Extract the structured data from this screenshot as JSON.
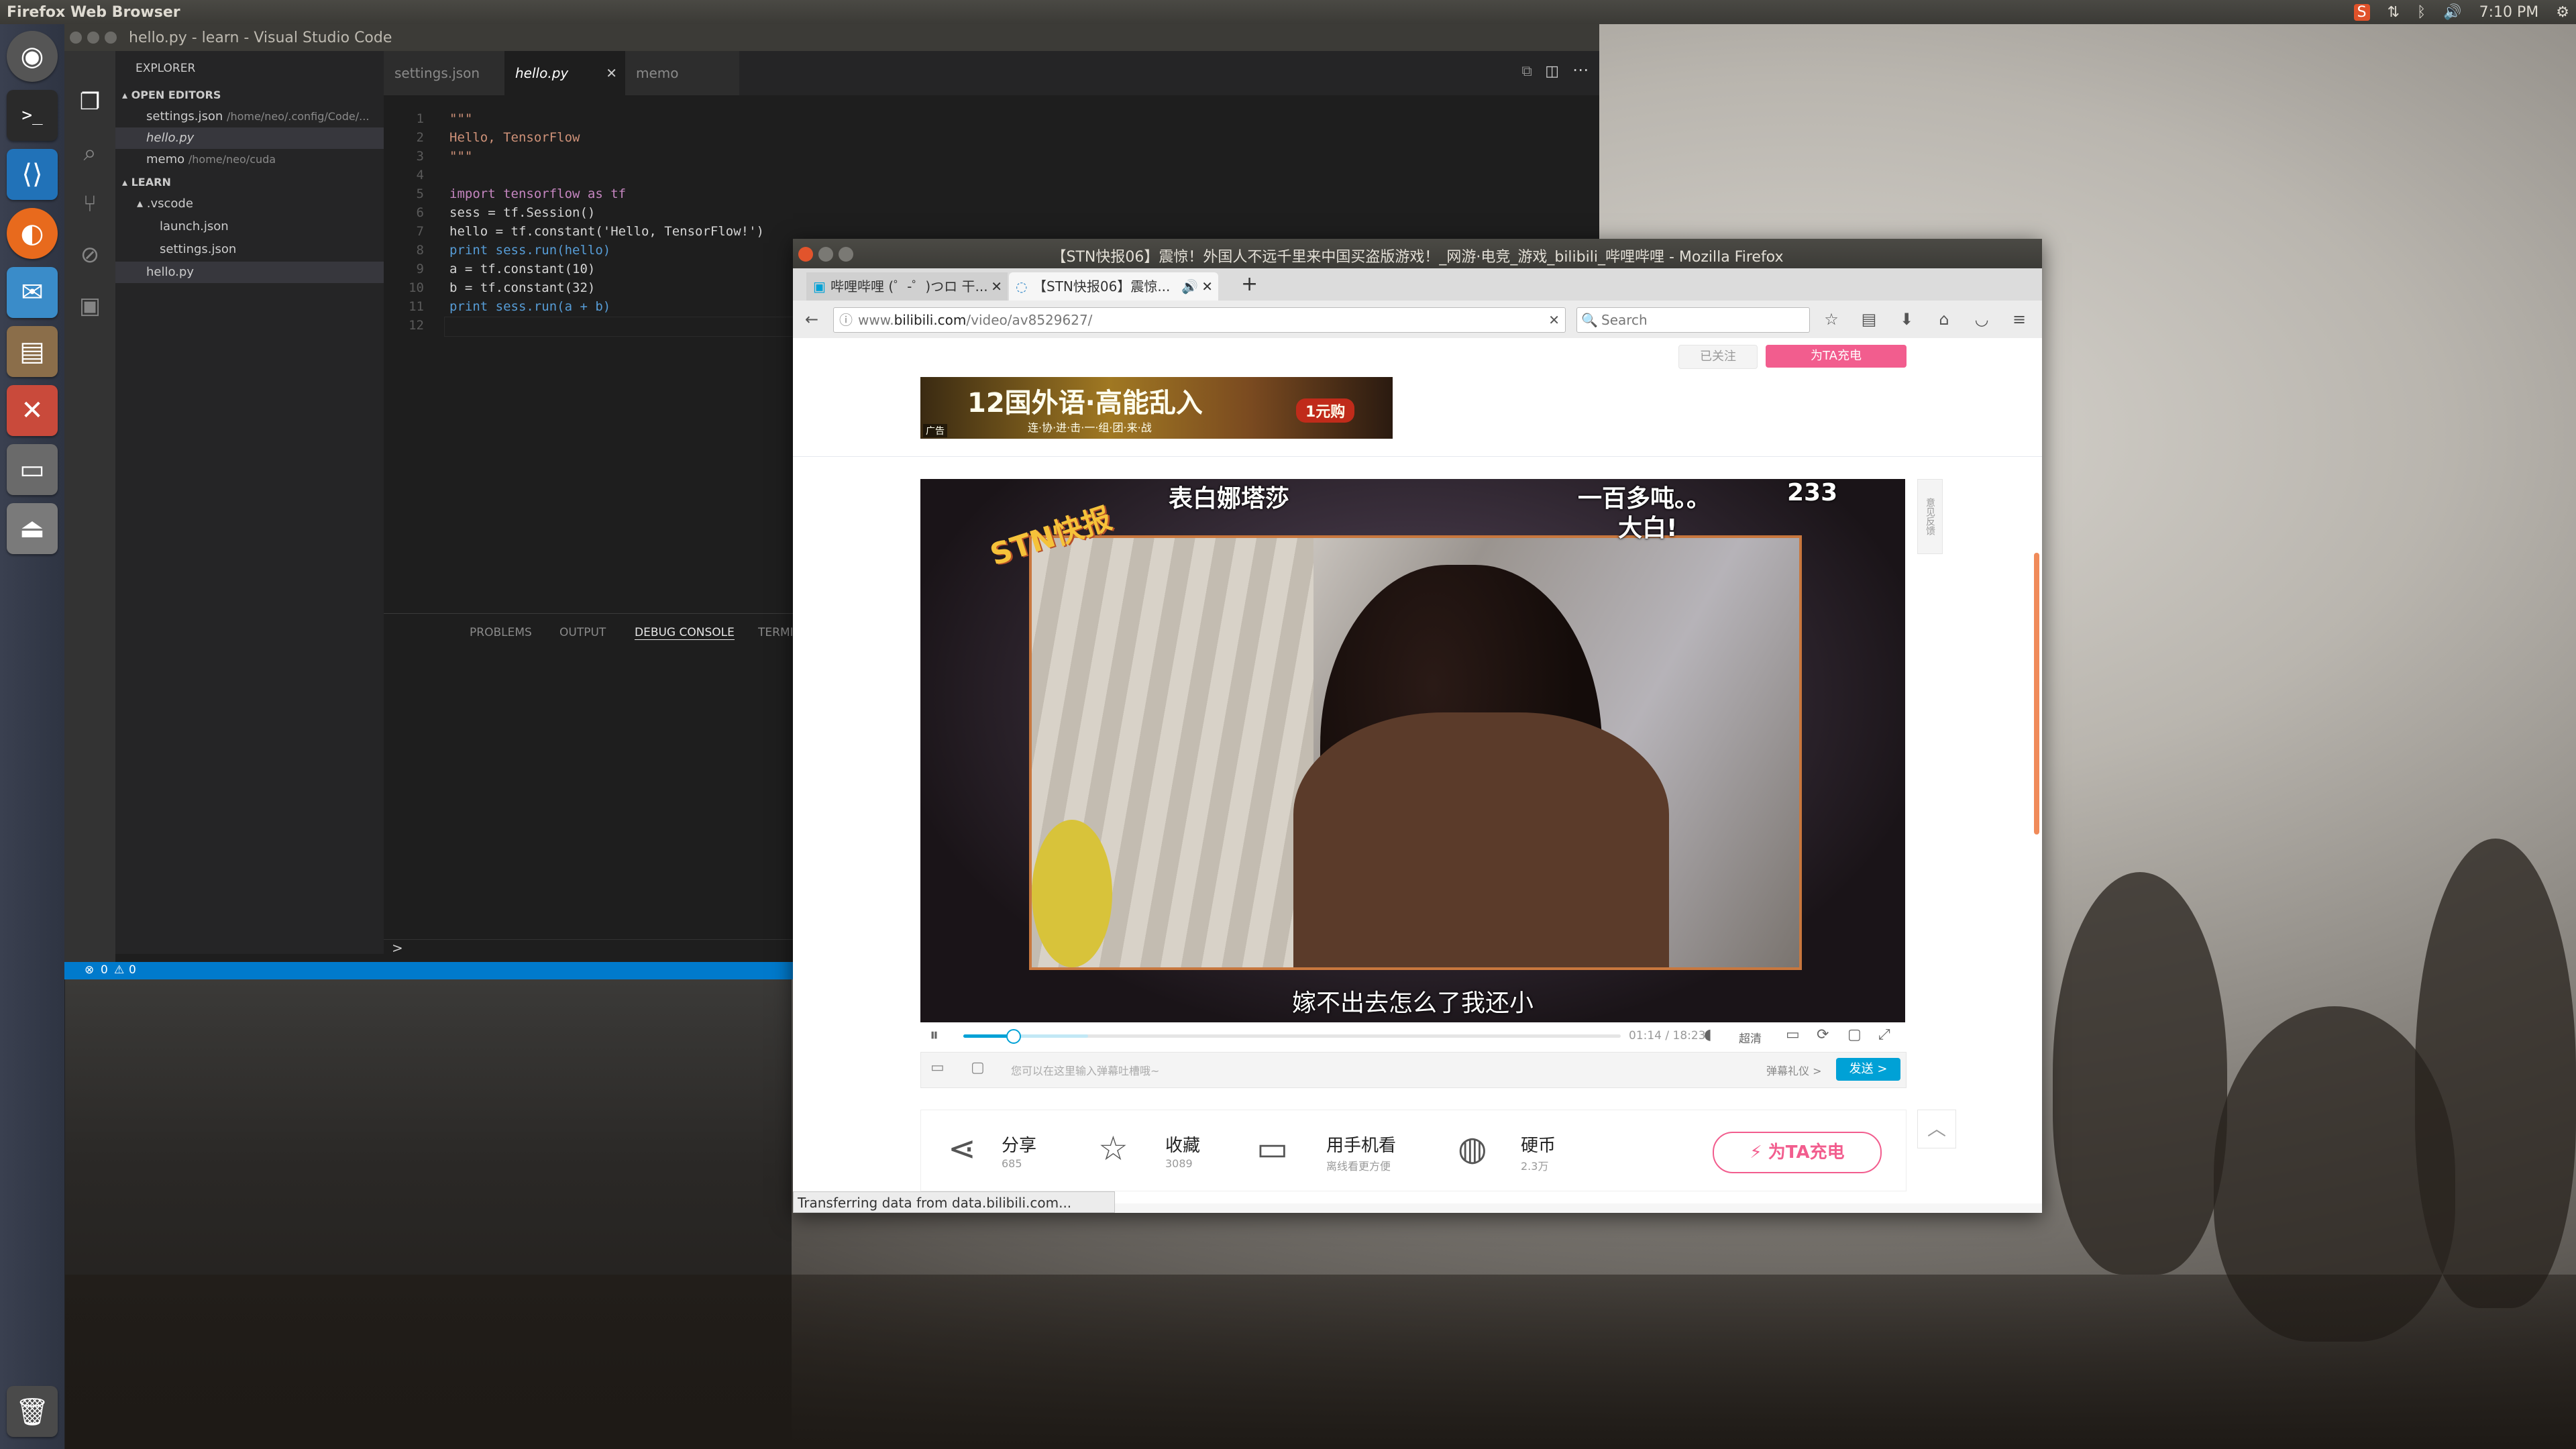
{
  "top_panel": {
    "title": "Firefox Web Browser",
    "time": "7:10 PM"
  },
  "vscode": {
    "window_title": "hello.py - learn - Visual Studio Code",
    "explorer_title": "EXPLORER",
    "open_editors_header": "OPEN EDITORS",
    "open_editors": [
      {
        "name": "settings.json",
        "path": "/home/neo/.config/Code/..."
      },
      {
        "name": "hello.py",
        "path": ""
      },
      {
        "name": "memo",
        "path": "/home/neo/cuda"
      }
    ],
    "learn_header": "LEARN",
    "tree": [
      {
        "name": ".vscode"
      },
      {
        "name": "launch.json"
      },
      {
        "name": "settings.json"
      },
      {
        "name": "hello.py"
      }
    ],
    "tabs": [
      {
        "label": "settings.json"
      },
      {
        "label": "hello.py"
      },
      {
        "label": "memo"
      }
    ],
    "code_lines": [
      "\"\"\"",
      "Hello, TensorFlow",
      "\"\"\"",
      "",
      "import tensorflow as tf",
      "sess = tf.Session()",
      "hello = tf.constant('Hello, TensorFlow!')",
      "print sess.run(hello)",
      "a = tf.constant(10)",
      "b = tf.constant(32)",
      "print sess.run(a + b)",
      ""
    ],
    "line_numbers": [
      "1",
      "2",
      "3",
      "4",
      "5",
      "6",
      "7",
      "8",
      "9",
      "10",
      "11",
      "12"
    ],
    "panel_tabs": [
      "PROBLEMS",
      "OUTPUT",
      "DEBUG CONSOLE",
      "TERMINAL"
    ],
    "prompt": ">",
    "status_errors": "0",
    "status_warnings": "0"
  },
  "firefox": {
    "window_title": "【STN快报06】震惊！外国人不远千里来中国买盗版游戏！_网游·电竞_游戏_bilibili_哔哩哔哩 - Mozilla Firefox",
    "tabs": [
      {
        "label": "哔哩哔哩 (゜-゜)つロ 干..."
      },
      {
        "label": "【STN快报06】震惊..."
      }
    ],
    "new_tab": "+",
    "url_prefix": "www.",
    "url_domain": "bilibili.com",
    "url_path": "/video/av8529627/",
    "search_placeholder": "Search",
    "status_text": "Transferring data from data.bilibili.com..."
  },
  "bilibili": {
    "follow_label": "已关注",
    "charge_label": "为TA充电",
    "ad_text": "12国外语·高能乱入",
    "ad_sub": "连·协·进·击·一·组·团·来·战",
    "ad_tag": "1元购",
    "ad_badge": "广告",
    "danmaku": [
      {
        "text": "表白娜塔莎"
      },
      {
        "text": "一百多吨。。"
      },
      {
        "text": "233"
      },
      {
        "text": "大白!"
      }
    ],
    "subtitle": "嫁不出去怎么了我还小",
    "logo_text": "STN快报",
    "time_display": "01:14 / 18:23",
    "quality": "超清",
    "feedback": "意见反馈",
    "danmaku_placeholder": "您可以在这里输入弹幕吐槽哦~",
    "danmaku_etiquette": "弹幕礼仪 >",
    "send_label": "发送 >",
    "progress": 0.076,
    "buffer": 0.19,
    "actions": [
      {
        "title": "分享",
        "sub": "685"
      },
      {
        "title": "收藏",
        "sub": "3089"
      },
      {
        "title": "用手机看",
        "sub": "离线看更方便"
      },
      {
        "title": "硬币",
        "sub": "2.3万"
      }
    ],
    "charge_button": "为TA充电",
    "accent": "#f25d8e",
    "send_color": "#00a1d6"
  }
}
